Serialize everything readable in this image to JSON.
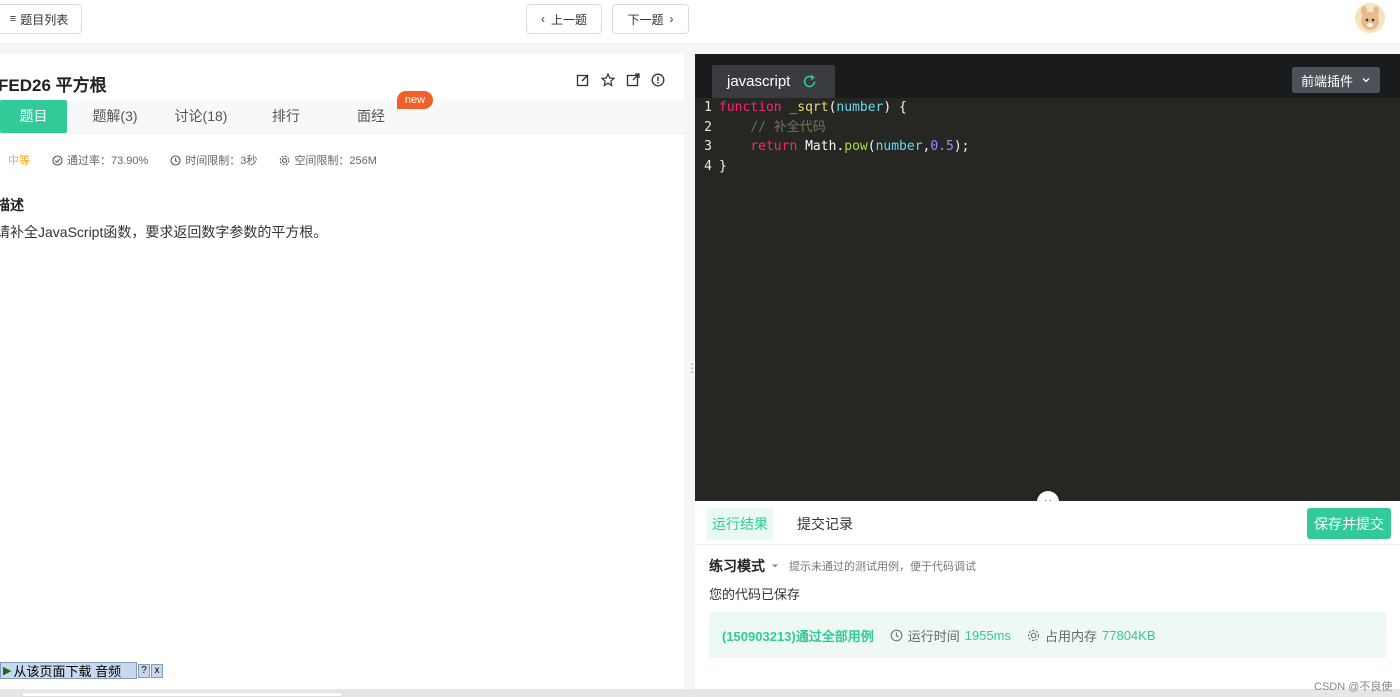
{
  "topbar": {
    "list_label": "题目列表",
    "prev_label": "上一题",
    "next_label": "下一题"
  },
  "problem": {
    "title": "FED26  平方根",
    "tabs": [
      {
        "label": "题目",
        "active": true
      },
      {
        "label": "题解(3)",
        "active": false
      },
      {
        "label": "讨论(18)",
        "active": false
      },
      {
        "label": "排行",
        "active": false
      },
      {
        "label": "面经",
        "active": false
      }
    ],
    "new_badge": "new",
    "difficulty": "中等",
    "pass_rate": "通过率：73.90%",
    "time_limit": "时间限制：3秒",
    "space_limit": "空间限制：256M",
    "desc_heading": "描述",
    "desc_text": "请补全JavaScript函数，要求返回数字参数的平方根。"
  },
  "download_bar": {
    "label": "从该页面下载 音频",
    "help": "?",
    "close": "x"
  },
  "editor": {
    "language": "javascript",
    "plugin_label": "前端插件",
    "lines": [
      {
        "num": "1"
      },
      {
        "num": "2"
      },
      {
        "num": "3"
      },
      {
        "num": "4"
      }
    ],
    "code": {
      "l1_kw": "function",
      "l1_fn": "_sqrt",
      "l1_paren_open": "(",
      "l1_param": "number",
      "l1_rest": ") {",
      "l2_comment": "// 补全代码",
      "l3_kw": "return",
      "l3_obj": "Math",
      "l3_dot": ".",
      "l3_call": "pow",
      "l3_open": "(",
      "l3_arg": "number",
      "l3_comma": ",",
      "l3_num": "0.5",
      "l3_close": ");",
      "l4": "}"
    }
  },
  "result": {
    "tab_result": "运行结果",
    "tab_history": "提交记录",
    "submit_label": "保存并提交",
    "mode_label": "练习模式",
    "mode_hint": "提示未通过的测试用例，便于代码调试",
    "saved_text": "您的代码已保存",
    "pass_text": "(150903213)通过全部用例",
    "runtime_label": "运行时间",
    "runtime_value": "1955ms",
    "memory_label": "占用内存",
    "memory_value": "77804KB"
  },
  "watermark": "CSDN @不良使",
  "colors": {
    "accent": "#32ca99",
    "badge": "#f0602a",
    "editor_bg": "#262622",
    "difficulty": "#f5a623"
  }
}
